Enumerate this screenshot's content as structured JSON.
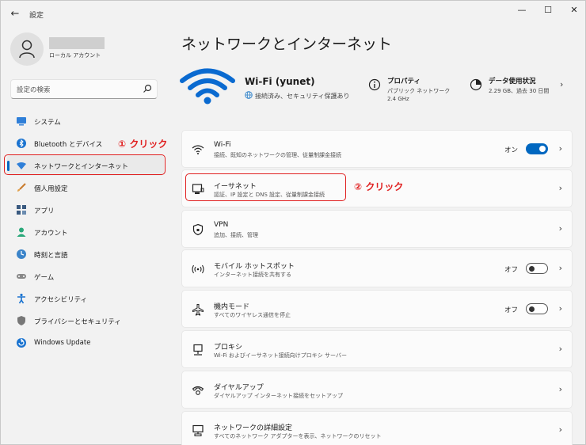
{
  "window": {
    "title": "設定",
    "back_icon": "arrow-left-icon",
    "controls": [
      "minimize",
      "maximize",
      "close"
    ]
  },
  "user": {
    "account_type": "ローカル アカウント"
  },
  "search": {
    "placeholder": "設定の検索"
  },
  "sidebar": {
    "items": [
      {
        "label": "システム",
        "icon": "system-icon",
        "active": false
      },
      {
        "label": "Bluetooth とデバイス",
        "icon": "bluetooth-icon",
        "active": false
      },
      {
        "label": "ネットワークとインターネット",
        "icon": "network-icon",
        "active": true
      },
      {
        "label": "個人用設定",
        "icon": "brush-icon",
        "active": false
      },
      {
        "label": "アプリ",
        "icon": "apps-icon",
        "active": false
      },
      {
        "label": "アカウント",
        "icon": "account-icon",
        "active": false
      },
      {
        "label": "時刻と言語",
        "icon": "time-language-icon",
        "active": false
      },
      {
        "label": "ゲーム",
        "icon": "gamepad-icon",
        "active": false
      },
      {
        "label": "アクセシビリティ",
        "icon": "accessibility-icon",
        "active": false
      },
      {
        "label": "プライバシーとセキュリティ",
        "icon": "shield-icon",
        "active": false
      },
      {
        "label": "Windows Update",
        "icon": "update-icon",
        "active": false
      }
    ]
  },
  "annotations": {
    "step1": "① クリック",
    "step2": "② クリック",
    "color": "#e02020"
  },
  "main": {
    "title": "ネットワークとインターネット",
    "network": {
      "name": "Wi-Fi (yunet)",
      "status": "接続済み、セキュリティ保護あり"
    },
    "properties": {
      "title": "プロパティ",
      "line1": "パブリック ネットワーク",
      "line2": "2.4 GHz"
    },
    "usage": {
      "title": "データ使用状況",
      "line1": "2.29 GB、過去 30 日間"
    },
    "cards": [
      {
        "title": "Wi-Fi",
        "subtitle": "接続、既知のネットワークの管理、従量制課金接続",
        "icon": "wifi-icon",
        "toggle": "on",
        "toggle_label": "オン"
      },
      {
        "title": "イーサネット",
        "subtitle": "認証、IP 設定と DNS 設定、従量制課金接続",
        "icon": "ethernet-icon"
      },
      {
        "title": "VPN",
        "subtitle": "追加、接続、管理",
        "icon": "vpn-shield-icon"
      },
      {
        "title": "モバイル ホットスポット",
        "subtitle": "インターネット接続を共有する",
        "icon": "hotspot-icon",
        "toggle": "off",
        "toggle_label": "オフ"
      },
      {
        "title": "機内モード",
        "subtitle": "すべてのワイヤレス通信を停止",
        "icon": "airplane-icon",
        "toggle": "off",
        "toggle_label": "オフ"
      },
      {
        "title": "プロキシ",
        "subtitle": "Wi-Fi およびイーサネット接続向けプロキシ サーバー",
        "icon": "proxy-icon"
      },
      {
        "title": "ダイヤルアップ",
        "subtitle": "ダイヤルアップ インターネット接続をセットアップ",
        "icon": "dialup-icon"
      },
      {
        "title": "ネットワークの詳細設定",
        "subtitle": "すべてのネットワーク アダプターを表示、ネットワークのリセット",
        "icon": "advanced-network-icon"
      }
    ]
  },
  "colors": {
    "accent": "#0067c0",
    "background": "#f2f2f2",
    "card": "#fbfbfb"
  }
}
